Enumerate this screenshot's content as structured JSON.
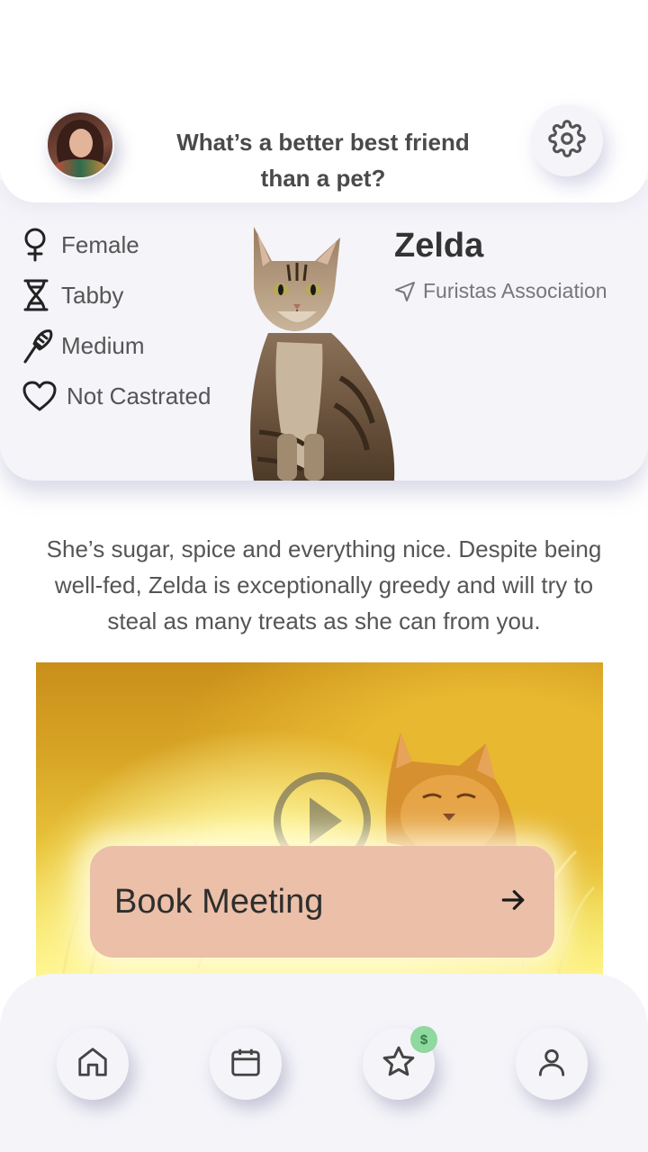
{
  "header": {
    "tagline": "What’s a better best friend than a pet?"
  },
  "pet": {
    "name": "Zelda",
    "association": "Furistas Association",
    "traits": [
      {
        "icon": "female-icon",
        "label": "Female"
      },
      {
        "icon": "dna-icon",
        "label": "Tabby"
      },
      {
        "icon": "brush-icon",
        "label": "Medium"
      },
      {
        "icon": "heart-icon",
        "label": "Not Castrated"
      }
    ],
    "description": "She’s sugar, spice and everything nice. Despite being well-fed, Zelda is exceptionally greedy and will try to steal as many treats as she can from you."
  },
  "video": {
    "play_icon": "play-icon"
  },
  "cta": {
    "label": "Book Meeting",
    "icon": "arrow-right-icon"
  },
  "nav": {
    "items": [
      {
        "icon": "home-icon"
      },
      {
        "icon": "calendar-icon"
      },
      {
        "icon": "star-icon"
      },
      {
        "icon": "user-icon"
      }
    ],
    "badge": "$"
  },
  "colors": {
    "card_bg": "#f4f4f9",
    "cta_bg": "#ebbfa8",
    "badge_bg": "#8fd8a0",
    "video_gold": "#d8a526"
  }
}
